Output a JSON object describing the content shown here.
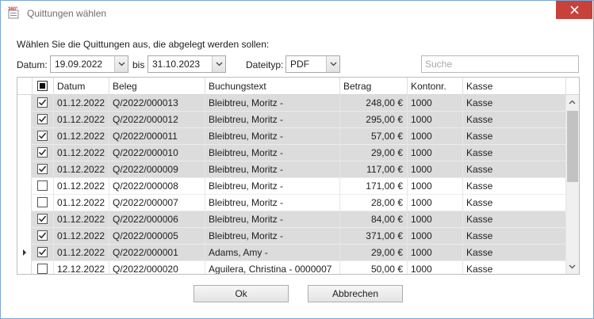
{
  "window": {
    "title": "Quittungen wählen"
  },
  "instruction": "Wählen Sie die Quittungen aus, die abgelegt werden sollen:",
  "filters": {
    "datum_label": "Datum:",
    "date_from": "19.09.2022",
    "bis_label": "bis",
    "date_to": "31.10.2023",
    "dateityp_label": "Dateityp:",
    "dateityp": "PDF",
    "search_placeholder": "Suche"
  },
  "columns": {
    "datum": "Datum",
    "beleg": "Beleg",
    "buchungstext": "Buchungstext",
    "betrag": "Betrag",
    "kontonr": "Kontonr.",
    "kasse": "Kasse"
  },
  "rows": [
    {
      "checked": true,
      "datum": "01.12.2022",
      "beleg": "Q/2022/000013",
      "text": "Bleibtreu, Moritz -",
      "betrag": "248,00 €",
      "konto": "1000",
      "kasse": "Kasse",
      "current": false
    },
    {
      "checked": true,
      "datum": "01.12.2022",
      "beleg": "Q/2022/000012",
      "text": "Bleibtreu, Moritz -",
      "betrag": "295,00 €",
      "konto": "1000",
      "kasse": "Kasse",
      "current": false
    },
    {
      "checked": true,
      "datum": "01.12.2022",
      "beleg": "Q/2022/000011",
      "text": "Bleibtreu, Moritz -",
      "betrag": "57,00 €",
      "konto": "1000",
      "kasse": "Kasse",
      "current": false
    },
    {
      "checked": true,
      "datum": "01.12.2022",
      "beleg": "Q/2022/000010",
      "text": "Bleibtreu, Moritz -",
      "betrag": "29,00 €",
      "konto": "1000",
      "kasse": "Kasse",
      "current": false
    },
    {
      "checked": true,
      "datum": "01.12.2022",
      "beleg": "Q/2022/000009",
      "text": "Bleibtreu, Moritz -",
      "betrag": "117,00 €",
      "konto": "1000",
      "kasse": "Kasse",
      "current": false
    },
    {
      "checked": false,
      "datum": "01.12.2022",
      "beleg": "Q/2022/000008",
      "text": "Bleibtreu, Moritz -",
      "betrag": "171,00 €",
      "konto": "1000",
      "kasse": "Kasse",
      "current": false
    },
    {
      "checked": false,
      "datum": "01.12.2022",
      "beleg": "Q/2022/000007",
      "text": "Bleibtreu, Moritz -",
      "betrag": "28,00 €",
      "konto": "1000",
      "kasse": "Kasse",
      "current": false
    },
    {
      "checked": true,
      "datum": "01.12.2022",
      "beleg": "Q/2022/000006",
      "text": "Bleibtreu, Moritz -",
      "betrag": "84,00 €",
      "konto": "1000",
      "kasse": "Kasse",
      "current": false
    },
    {
      "checked": true,
      "datum": "01.12.2022",
      "beleg": "Q/2022/000005",
      "text": "Bleibtreu, Moritz -",
      "betrag": "371,00 €",
      "konto": "1000",
      "kasse": "Kasse",
      "current": false
    },
    {
      "checked": true,
      "datum": "01.12.2022",
      "beleg": "Q/2022/000001",
      "text": "Adams, Amy -",
      "betrag": "29,00 €",
      "konto": "1000",
      "kasse": "Kasse",
      "current": true
    },
    {
      "checked": false,
      "datum": "12.12.2022",
      "beleg": "Q/2022/000020",
      "text": "Aguilera, Christina - 0000007",
      "betrag": "50,00 €",
      "konto": "1000",
      "kasse": "Kasse",
      "current": false
    }
  ],
  "buttons": {
    "ok": "Ok",
    "cancel": "Abbrechen"
  },
  "colors": {
    "close": "#c7423a",
    "selected_row": "#dcdcdc",
    "border_accent": "#7aa7d8"
  },
  "icons": {
    "app": "app-360-icon",
    "close": "close-icon",
    "check": "checkmark-icon"
  }
}
